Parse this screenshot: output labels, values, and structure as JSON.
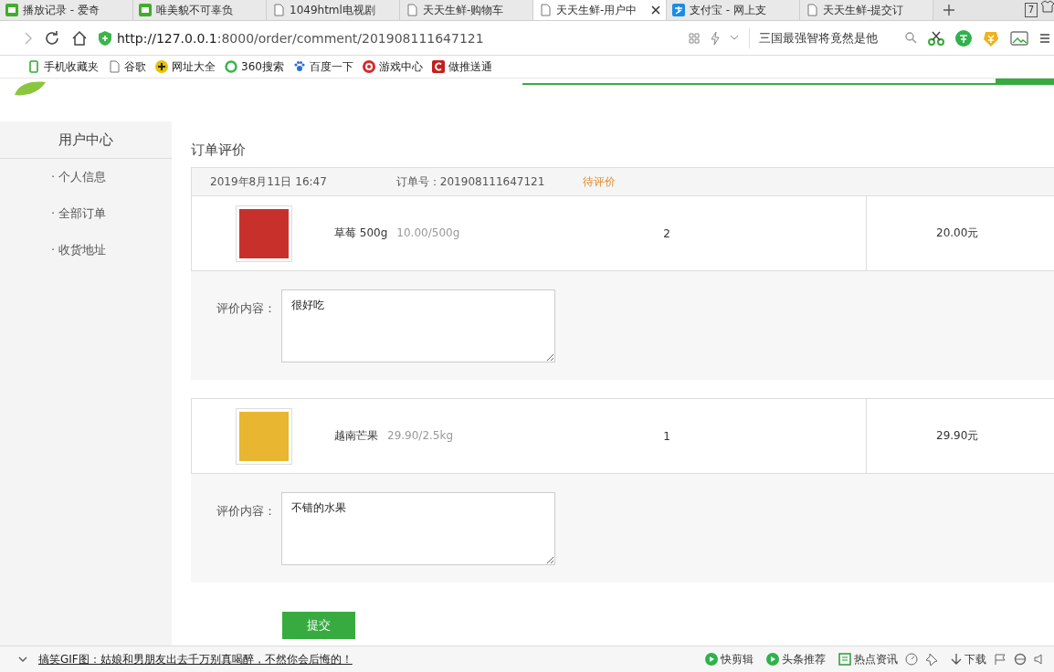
{
  "browser": {
    "tabs": [
      {
        "title": "播放记录 - 爱奇",
        "kind": "video",
        "selected": false
      },
      {
        "title": "唯美貌不可辜负",
        "kind": "video",
        "selected": false
      },
      {
        "title": "1049html电视剧",
        "kind": "page",
        "selected": false
      },
      {
        "title": "天天生鲜-购物车",
        "kind": "page",
        "selected": false
      },
      {
        "title": "天天生鲜-用户中",
        "kind": "page",
        "selected": true
      },
      {
        "title": "支付宝 - 网上支",
        "kind": "pay",
        "selected": false
      },
      {
        "title": "天天生鲜-提交订",
        "kind": "page",
        "selected": false
      }
    ],
    "tab_count": "7",
    "url_host": "http://127.0.0.1",
    "url_rest": ":8000/order/comment/201908111647121",
    "search_hint": "三国最强智将竟然是他",
    "bookmarks": [
      {
        "label": "手机收藏夹",
        "kind": "phone"
      },
      {
        "label": "谷歌",
        "kind": "page"
      },
      {
        "label": "网址大全",
        "kind": "plus"
      },
      {
        "label": "360搜索",
        "kind": "ring"
      },
      {
        "label": "百度一下",
        "kind": "paw"
      },
      {
        "label": "游戏中心",
        "kind": "game"
      },
      {
        "label": "做推送通",
        "kind": "c"
      }
    ]
  },
  "sidebar": {
    "title": "用户中心",
    "items": [
      "· 个人信息",
      "· 全部订单",
      "· 收货地址"
    ]
  },
  "main": {
    "title": "订单评价",
    "order": {
      "date": "2019年8月11日 16:47",
      "number": "订单号：201908111647121",
      "status": "待评价"
    },
    "items": [
      {
        "name": "草莓 500g",
        "price": "10.00/500g",
        "quantity": "2",
        "total": "20.00元",
        "comment_label": "评价内容：",
        "comment": "很好吃"
      },
      {
        "name": "越南芒果",
        "price": "29.90/2.5kg",
        "quantity": "1",
        "total": "29.90元",
        "comment_label": "评价内容：",
        "comment": "不错的水果"
      }
    ],
    "submit": "提交"
  },
  "status_bar": {
    "headline": "搞笑GIF图：姑娘和男朋友出去千万别真喝醉，不然你会后悔的！",
    "links": [
      "快剪辑",
      "头条推荐",
      "热点资讯"
    ],
    "download": "下载"
  }
}
